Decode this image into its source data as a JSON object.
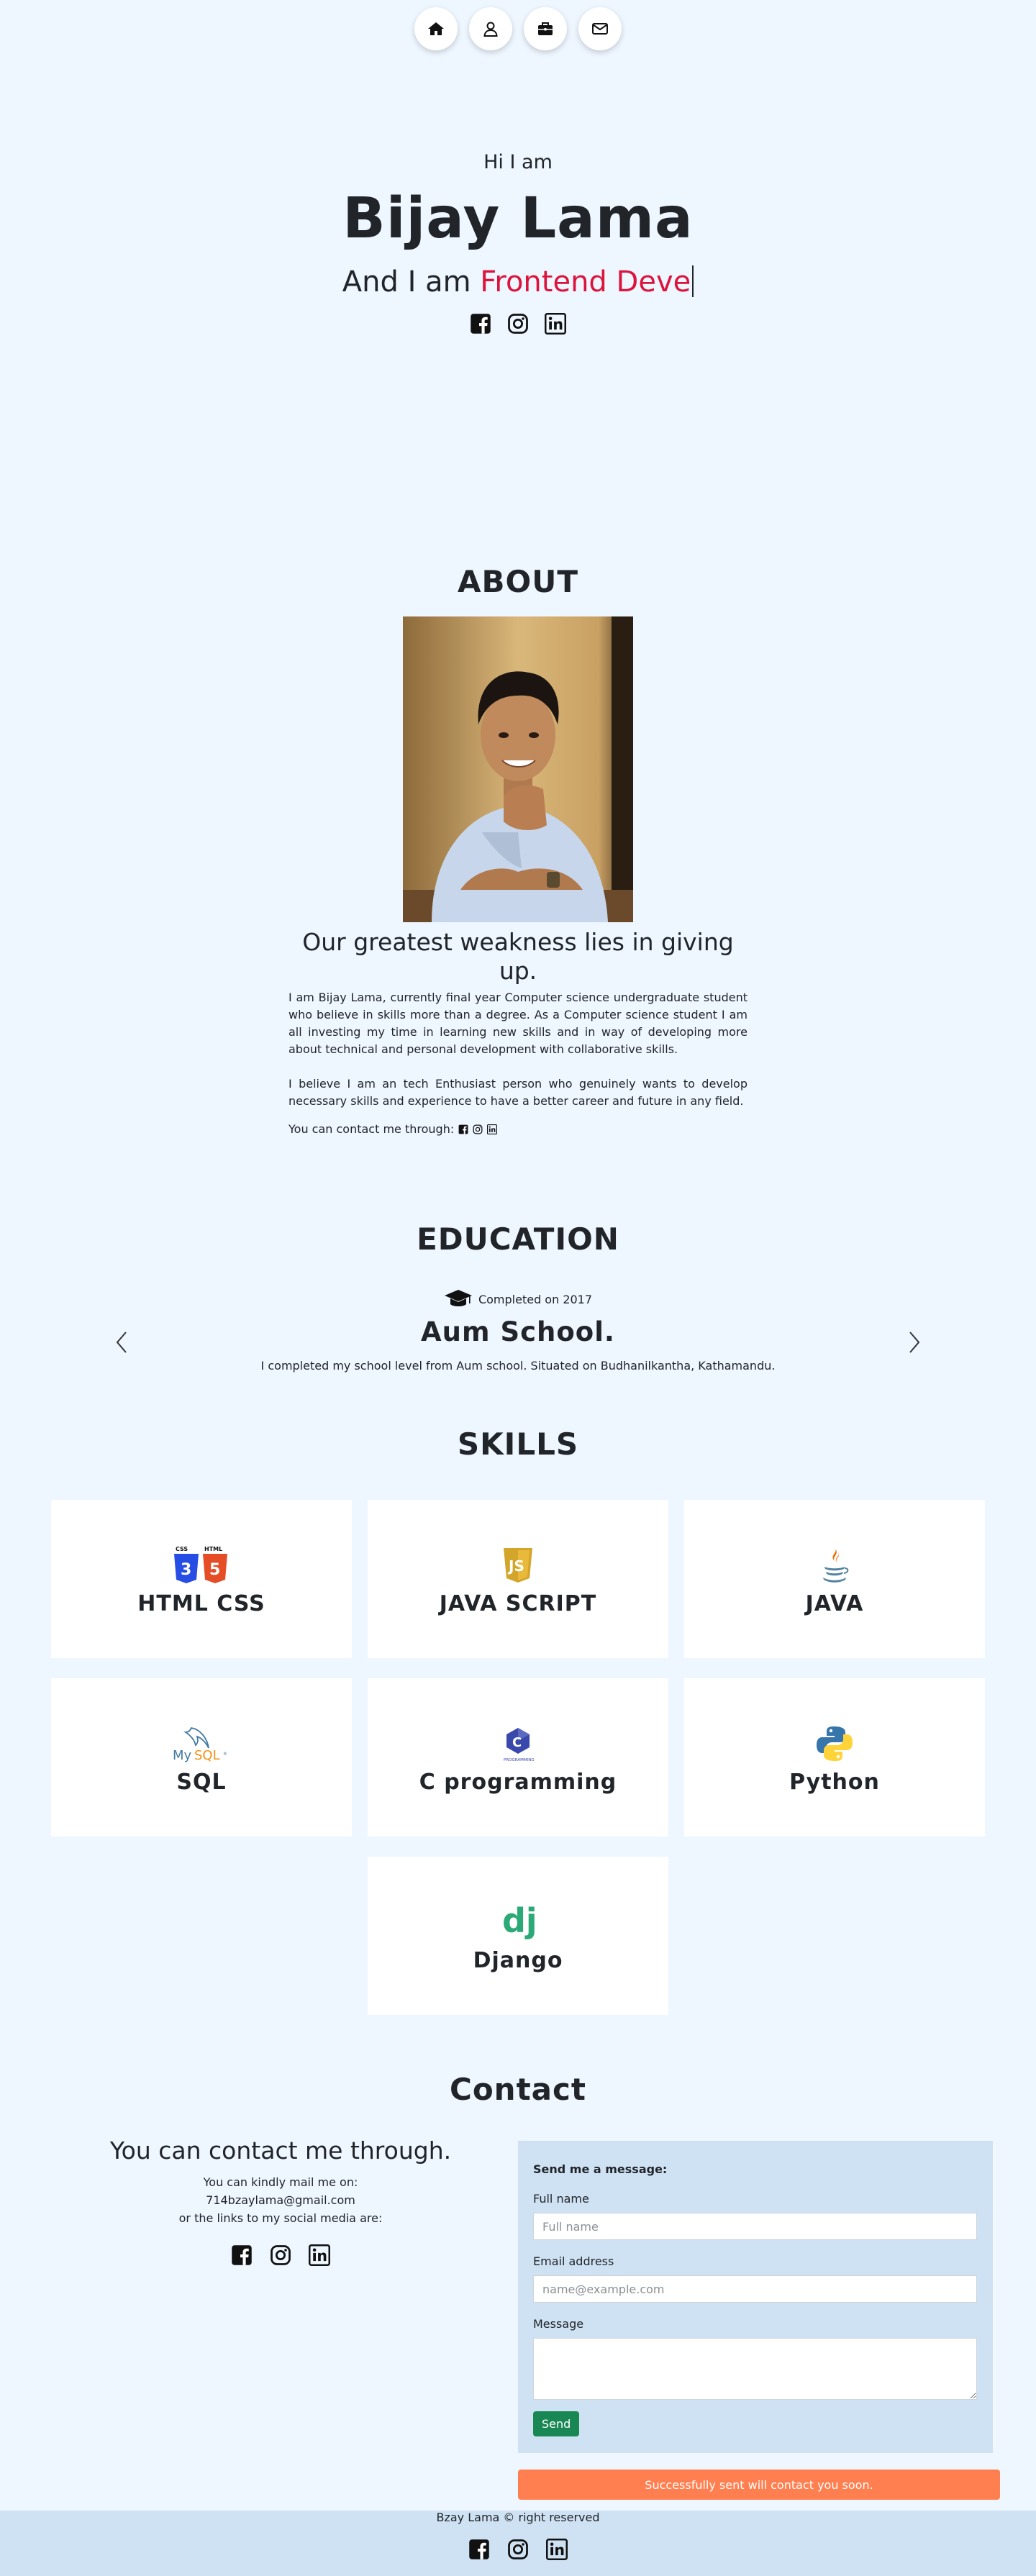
{
  "nav": {
    "items": [
      {
        "name": "home",
        "icon": "home-icon"
      },
      {
        "name": "about",
        "icon": "user-icon"
      },
      {
        "name": "education",
        "icon": "briefcase-icon"
      },
      {
        "name": "contact",
        "icon": "envelope-icon"
      }
    ]
  },
  "hero": {
    "greeting": "Hi I am",
    "name": "Bijay Lama",
    "typed_prefix": "And I am ",
    "typed_role": "Frontend Deve",
    "socials": [
      "facebook-icon",
      "instagram-icon",
      "linkedin-icon"
    ]
  },
  "about": {
    "title": "ABOUT",
    "quote": "Our greatest weakness lies in giving up.",
    "paragraph1": "I am Bijay Lama, currently final year Computer science undergraduate student who believe in skills more than a degree. As a Computer science student I am all investing my time in learning new skills and in way of developing more about technical and personal development with collaborative skills.",
    "paragraph2": "I believe I am an tech Enthusiast person who genuinely wants to develop necessary skills and experience to have a better career and future in any field.",
    "contact_label": "You can contact me through:"
  },
  "education": {
    "title": "EDUCATION",
    "completed": "Completed on 2017",
    "school": "Aum School.",
    "description": "I completed my school level from Aum school. Situated on Budhanilkantha, Kathamandu."
  },
  "skills": {
    "title": "SKILLS",
    "items": [
      {
        "label": "HTML CSS",
        "icon": "html-css-icon"
      },
      {
        "label": "JAVA SCRIPT",
        "icon": "javascript-icon"
      },
      {
        "label": "JAVA",
        "icon": "java-icon"
      },
      {
        "label": "SQL",
        "icon": "mysql-icon"
      },
      {
        "label": "C programming",
        "icon": "c-icon"
      },
      {
        "label": "Python",
        "icon": "python-icon"
      },
      {
        "label": "Django",
        "icon": "django-icon"
      }
    ]
  },
  "contact": {
    "title": "Contact",
    "lead": "You can contact me through.",
    "mail_label": "You can kindly mail me on:",
    "email": "714bzaylama@gmail.com",
    "social_label": "or the links to my social media are:",
    "form": {
      "title": "Send me a message:",
      "name_label": "Full name",
      "name_placeholder": "Full name",
      "email_label": "Email address",
      "email_placeholder": "name@example.com",
      "message_label": "Message",
      "send_label": "Send"
    },
    "toast": "Successfully sent will contact you soon."
  },
  "footer": {
    "copyright": "Bzay Lama © right reserved"
  },
  "colors": {
    "background": "#eef6ff",
    "accent_role": "#dc143c",
    "form_bg": "#cfe2f3",
    "send_button": "#198754",
    "toast_bg": "#ff7f50"
  }
}
